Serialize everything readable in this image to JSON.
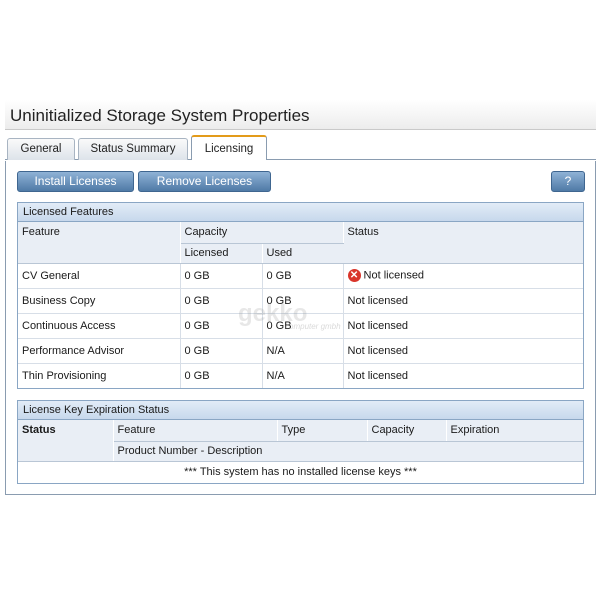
{
  "window": {
    "title": "Uninitialized Storage System Properties"
  },
  "tabs": [
    {
      "label": "General"
    },
    {
      "label": "Status Summary"
    },
    {
      "label": "Licensing"
    }
  ],
  "toolbar": {
    "install_label": "Install Licenses",
    "remove_label": "Remove Licenses",
    "help_label": "?"
  },
  "licensed_features": {
    "title": "Licensed Features",
    "headers": {
      "feature": "Feature",
      "capacity": "Capacity",
      "licensed": "Licensed",
      "used": "Used",
      "status": "Status"
    },
    "rows": [
      {
        "feature": "CV General",
        "licensed": "0 GB",
        "used": "0 GB",
        "status": "Not licensed"
      },
      {
        "feature": "Business Copy",
        "licensed": "0 GB",
        "used": "0 GB",
        "status": "Not licensed"
      },
      {
        "feature": "Continuous Access",
        "licensed": "0 GB",
        "used": "0 GB",
        "status": "Not licensed"
      },
      {
        "feature": "Performance Advisor",
        "licensed": "0 GB",
        "used": "N/A",
        "status": "Not licensed"
      },
      {
        "feature": "Thin Provisioning",
        "licensed": "0 GB",
        "used": "N/A",
        "status": "Not licensed"
      }
    ]
  },
  "expiration": {
    "title": "License Key Expiration Status",
    "headers": {
      "status": "Status",
      "feature": "Feature",
      "type": "Type",
      "capacity": "Capacity",
      "expiration": "Expiration",
      "product": "Product Number - Description"
    },
    "empty_message": "*** This system has no installed license keys ***"
  },
  "watermark": {
    "brand": "gekko",
    "sub": "computer gmbh"
  },
  "colors": {
    "accent": "#e39b1a",
    "button": "#4f7aa6",
    "error": "#d9352b"
  }
}
